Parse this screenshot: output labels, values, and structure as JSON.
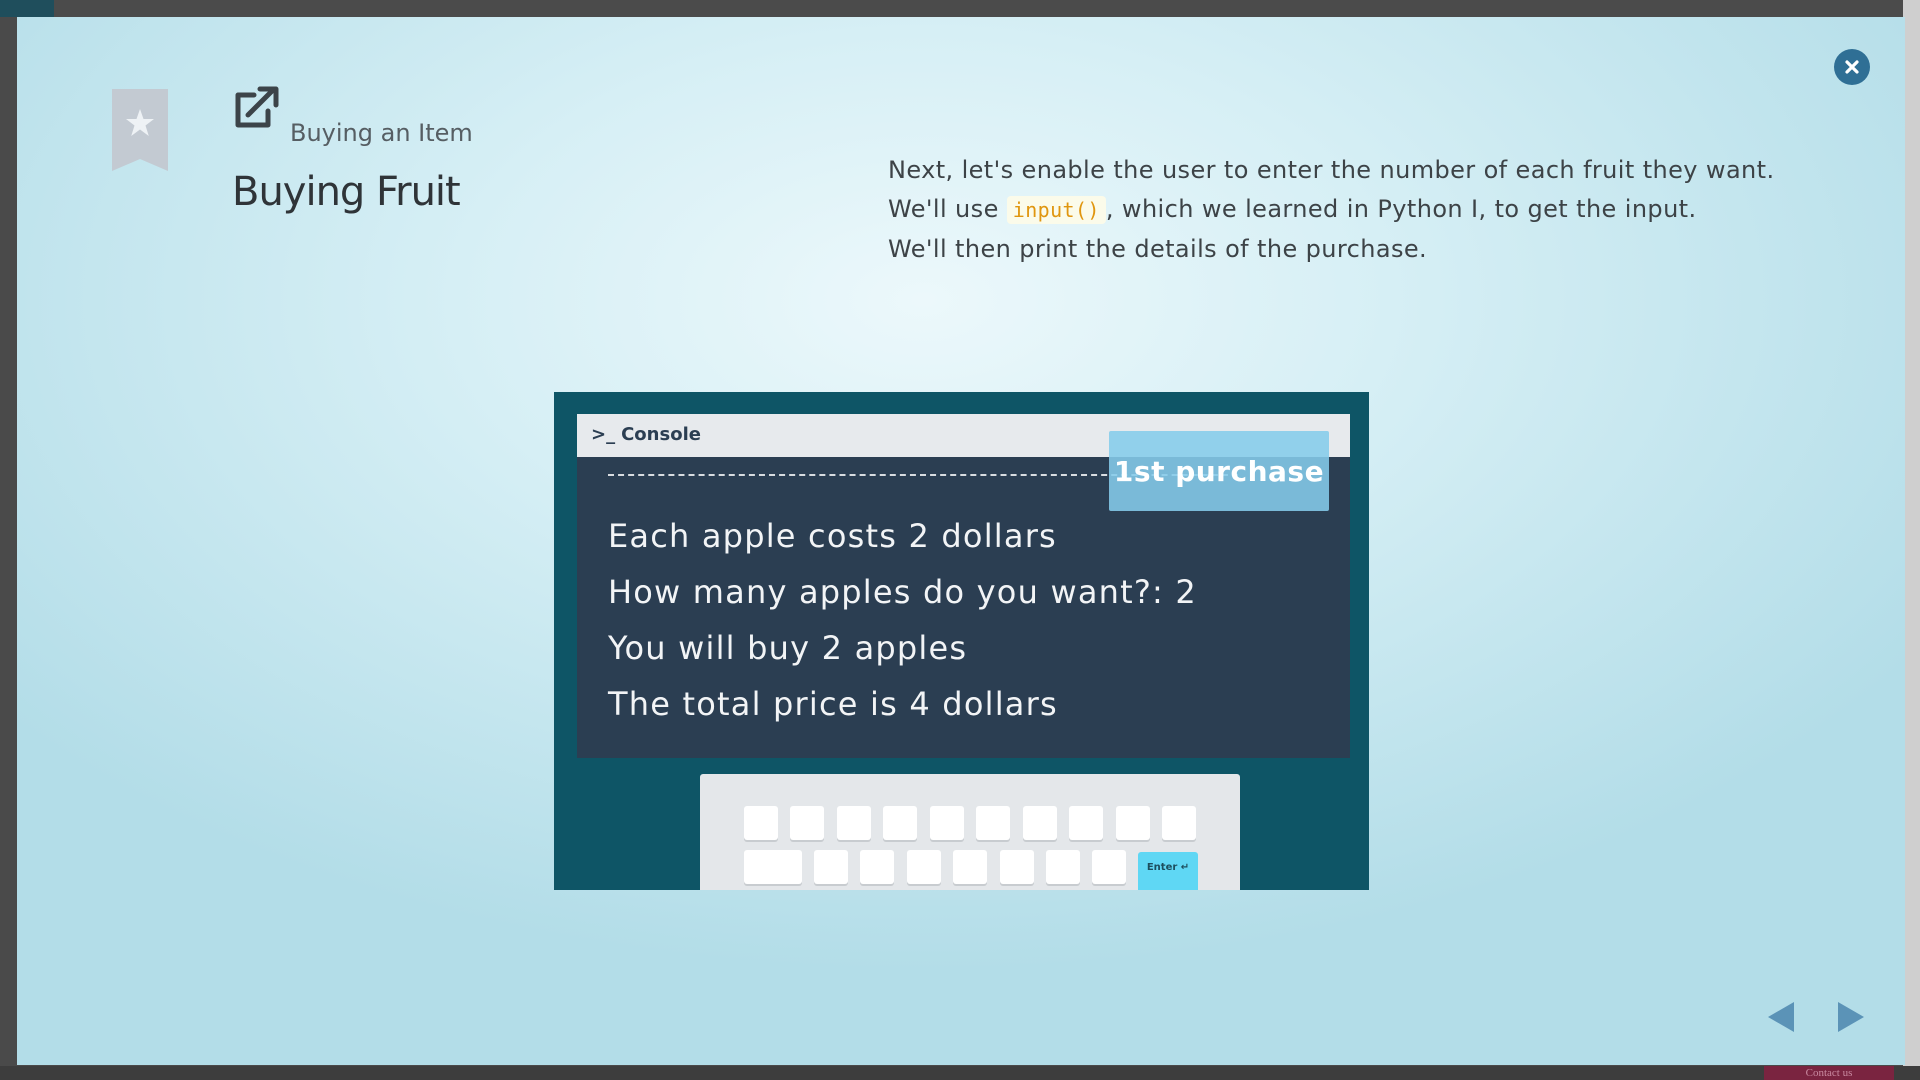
{
  "lesson": {
    "subtitle": "Buying an Item",
    "title": "Buying Fruit"
  },
  "description": {
    "line1": "Next, let's enable the user to enter the number of each fruit they want.",
    "line2_before": "We'll use ",
    "line2_code": "input()",
    "line2_after": ", which we learned in Python I, to get the input.",
    "line3": "We'll then print the details of the purchase."
  },
  "console": {
    "label": "Console",
    "prompt_symbol": ">_",
    "badge": "1st purchase",
    "lines": [
      "Each apple costs 2 dollars",
      "How many apples do you want?: 2",
      "You will buy 2 apples",
      "The total price is 4 dollars"
    ]
  },
  "keyboard": {
    "enter_label": "Enter ↵"
  },
  "footer": {
    "contact_label": "Contact us"
  },
  "icons": {
    "bookmark": "bookmark-star-icon",
    "external": "external-link-icon",
    "close": "close-icon",
    "prev": "prev-arrow-icon",
    "next": "next-arrow-icon"
  },
  "colors": {
    "accent": "#2f6f95",
    "nav_arrow": "#5b93b7",
    "console_bg": "#2b3e52",
    "figure_bg": "#0e5566",
    "badge_bg": "#85ccea",
    "code_text": "#e0960f",
    "enter_key": "#5fd7f4"
  }
}
